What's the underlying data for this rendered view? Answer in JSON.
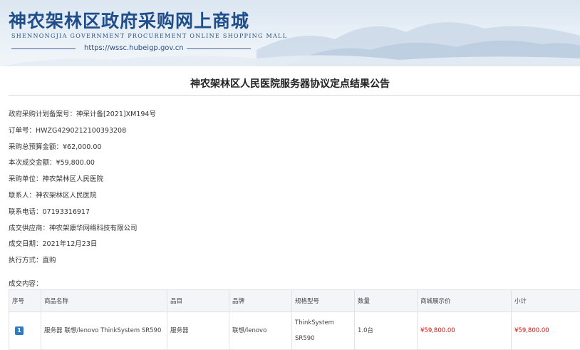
{
  "header": {
    "site_title": "神农架林区政府采购网上商城",
    "site_subtitle": "SHENNONGJIA GOVERNMENT PROCUREMENT ONLINE SHOPPING MALL",
    "site_url": "https://wssc.hubeigp.gov.cn"
  },
  "notice": {
    "title": "神农架林区人民医院服务器协议定点结果公告"
  },
  "fields": [
    {
      "label": "政府采购计划备案号：",
      "value": "神采计备[2021]XM194号"
    },
    {
      "label": "订单号：",
      "value": "HWZG4290212100393208"
    },
    {
      "label": "采购总预算金额：",
      "value": "¥62,000.00"
    },
    {
      "label": "本次成交金额：",
      "value": "¥59,800.00"
    },
    {
      "label": "采购单位：",
      "value": "神农架林区人民医院"
    },
    {
      "label": "联系人：",
      "value": "神农架林区人民医院"
    },
    {
      "label": "联系电话：",
      "value": "07193316917"
    },
    {
      "label": "成交供应商：",
      "value": "神农架康华网络科技有限公司"
    },
    {
      "label": "成交日期：",
      "value": "2021年12月23日"
    },
    {
      "label": "执行方式：",
      "value": "直购"
    }
  ],
  "deal_content_label": "成交内容：",
  "table": {
    "headers": [
      "序号",
      "商品名称",
      "品目",
      "品牌",
      "规格型号",
      "数量",
      "商城展示价",
      "小计"
    ],
    "rows": [
      {
        "seq": "1",
        "name": "服务器 联想/lenovo ThinkSystem SR590",
        "category": "服务器",
        "brand": "联想/lenovo",
        "model": "ThinkSystem SR590",
        "qty": "1.0台",
        "price": "¥59,800.00",
        "subtotal": "¥59,800.00"
      }
    ]
  },
  "colors": {
    "brand_blue": "#1f4e8a",
    "price_red": "#d9120f",
    "badge_blue": "#2f7bbf"
  }
}
